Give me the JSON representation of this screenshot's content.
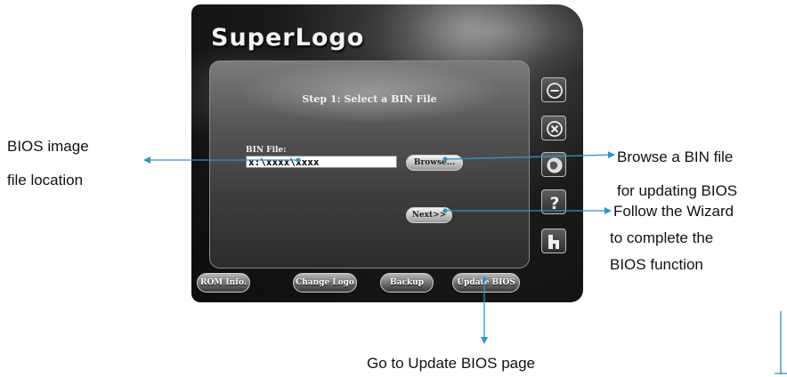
{
  "app": {
    "logo_text": "SuperLogo",
    "step_title": "Step 1: Select a BIN File",
    "bin_label": "BIN File:",
    "bin_value": "x:\\xxxx\\xxxx",
    "browse_label": "Browse...",
    "next_label": "Next>>",
    "bottom_buttons": [
      "ROM Info.",
      "Change Logo",
      "Backup",
      "Update BIOS"
    ],
    "side_icons": [
      "minimize-icon",
      "close-icon",
      "globe-icon",
      "help-icon",
      "home-icon"
    ]
  },
  "annotations": {
    "bios_image_line1": "BIOS image",
    "bios_image_line2": "file location",
    "browse_line1": "Browse a BIN file",
    "browse_line2": "for updating BIOS",
    "wizard_line1": "Follow the Wizard",
    "wizard_line2": "to complete the",
    "wizard_line3": "BIOS function",
    "update_page": "Go to Update BIOS page"
  },
  "colors": {
    "arrow": "#2b95c9"
  }
}
